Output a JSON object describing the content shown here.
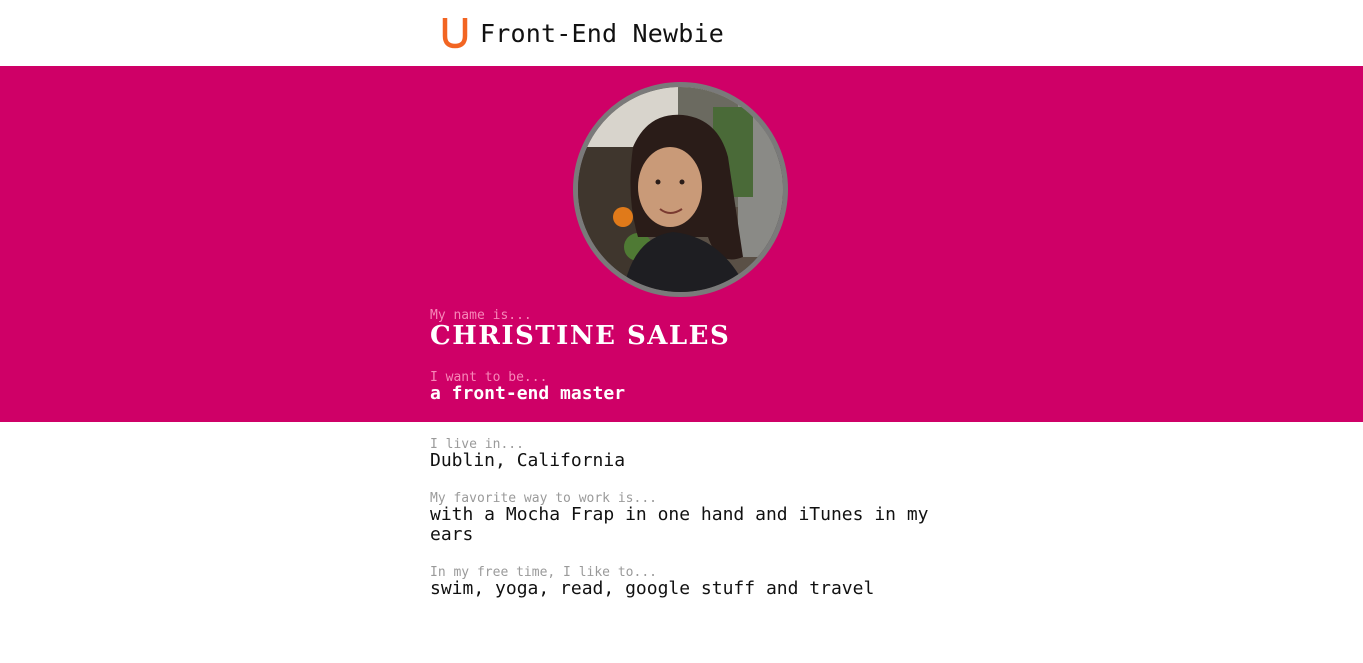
{
  "header": {
    "logo_icon": "u-logo-icon",
    "logo_color": "#f26522",
    "title": "Front-End Newbie"
  },
  "hero": {
    "background_color": "#cf0067",
    "avatar_icon": "profile-photo",
    "name": {
      "label": "My name is...",
      "value": "CHRISTINE SALES"
    },
    "goal": {
      "label": "I want to be...",
      "value": "a front-end master"
    }
  },
  "details": {
    "location": {
      "label": "I live in...",
      "value": "Dublin, California"
    },
    "work_style": {
      "label": "My favorite way to work is...",
      "value": "with a Mocha Frap in one hand and iTunes in my ears"
    },
    "free_time": {
      "label": "In my free time, I like to...",
      "value": "swim, yoga, read, google stuff and travel"
    }
  }
}
